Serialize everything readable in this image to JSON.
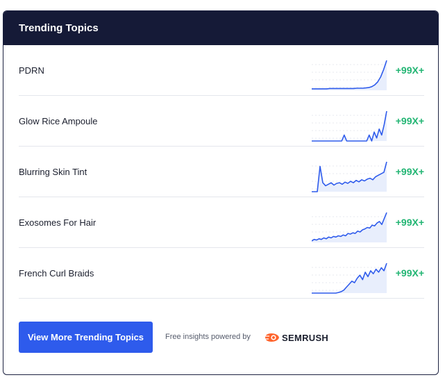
{
  "widget": {
    "title": "Trending Topics",
    "topics": [
      {
        "label": "PDRN",
        "growth": "+99X+",
        "trend": [
          5,
          5,
          5,
          5,
          5,
          5,
          6,
          6,
          6,
          6,
          6,
          6,
          6,
          6,
          6,
          7,
          7,
          7,
          8,
          9,
          12,
          18,
          28,
          45,
          70,
          100
        ]
      },
      {
        "label": "Glow Rice Ampoule",
        "growth": "+99X+",
        "trend": [
          0,
          0,
          0,
          0,
          0,
          0,
          0,
          0,
          0,
          0,
          0,
          0,
          0,
          20,
          0,
          0,
          0,
          0,
          0,
          0,
          0,
          0,
          0,
          20,
          0,
          30,
          10,
          40,
          20,
          55,
          100
        ]
      },
      {
        "label": "Blurring Skin Tint",
        "growth": "+99X+",
        "trend": [
          0,
          0,
          0,
          85,
          30,
          20,
          25,
          30,
          22,
          28,
          30,
          25,
          32,
          28,
          35,
          30,
          38,
          33,
          40,
          36,
          42,
          45,
          40,
          50,
          55,
          60,
          65,
          100
        ]
      },
      {
        "label": "Exosomes For Hair",
        "growth": "+99X+",
        "trend": [
          5,
          10,
          8,
          12,
          10,
          15,
          12,
          18,
          15,
          20,
          18,
          22,
          20,
          25,
          22,
          30,
          28,
          32,
          30,
          38,
          35,
          42,
          45,
          50,
          48,
          58,
          55,
          65,
          70,
          60,
          80,
          100
        ]
      },
      {
        "label": "French Curl Braids",
        "growth": "+99X+",
        "trend": [
          0,
          0,
          0,
          0,
          0,
          0,
          0,
          0,
          0,
          0,
          2,
          5,
          10,
          20,
          30,
          40,
          35,
          50,
          60,
          45,
          70,
          55,
          75,
          65,
          80,
          70,
          85,
          75,
          100
        ]
      }
    ],
    "colors": {
      "header": "#151a37",
      "growth": "#22b573",
      "button": "#2e5bec",
      "spark": "#2e5bec"
    },
    "footer": {
      "button_label": "View More Trending Topics",
      "powered_text": "Free insights powered by",
      "brand_name": "SEMRUSH",
      "brand_icon": "semrush-flame-icon"
    }
  }
}
